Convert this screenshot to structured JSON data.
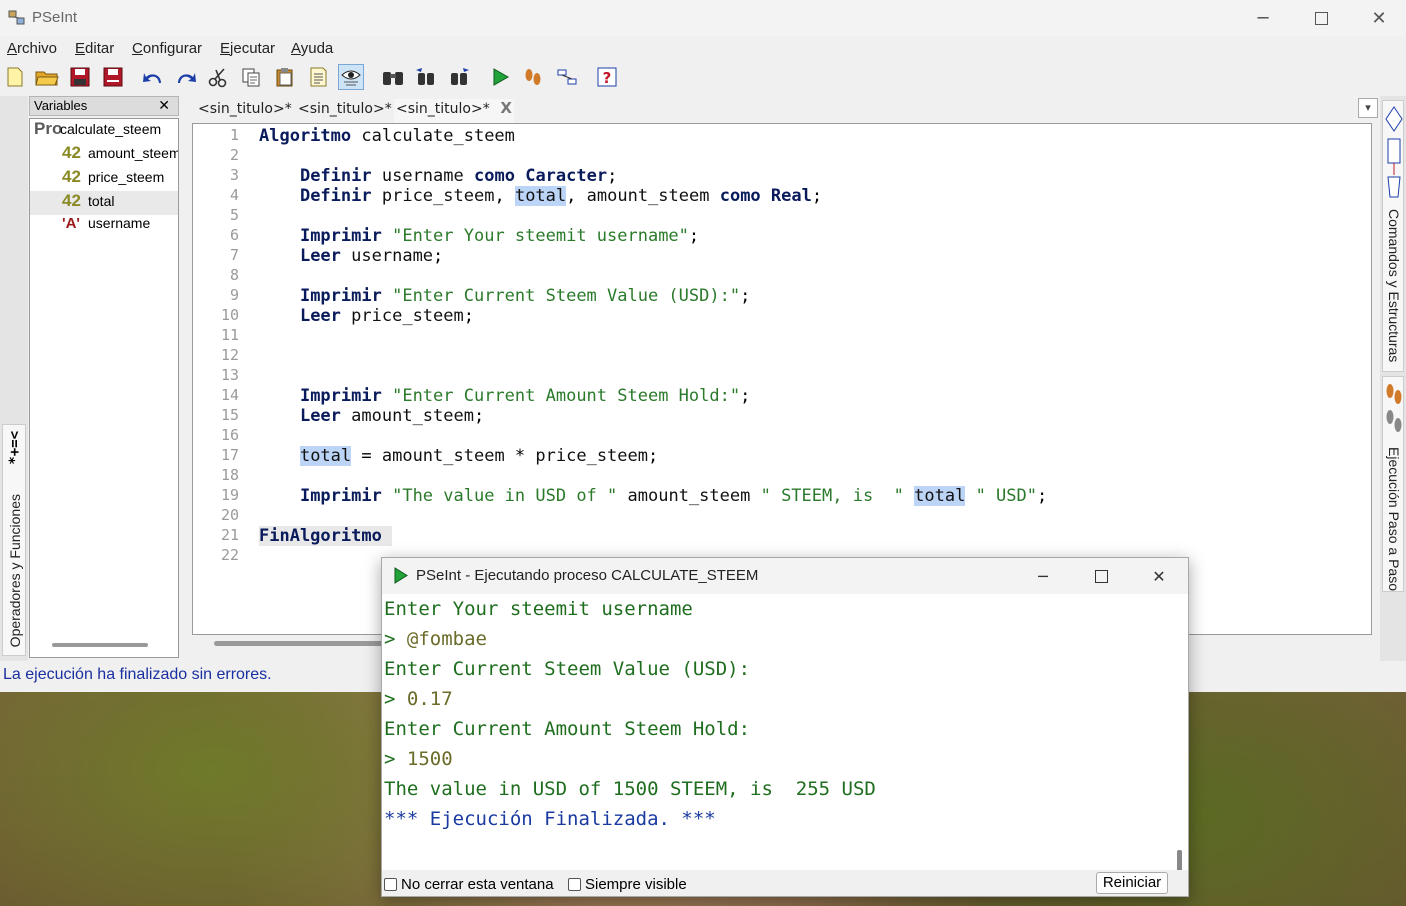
{
  "window": {
    "title": "PSeInt"
  },
  "menu": [
    {
      "ul": "A",
      "rest": "rchivo"
    },
    {
      "ul": "E",
      "rest": "ditar"
    },
    {
      "ul": "C",
      "rest": "onfigurar"
    },
    {
      "ul": "E",
      "rest": "jecutar"
    },
    {
      "ul": "A",
      "rest": "yuda"
    }
  ],
  "variables_panel": {
    "title": "Variables",
    "close": "✕",
    "items": [
      {
        "icon": "Pro",
        "name": "calculate_steem"
      },
      {
        "icon": "42",
        "name": "amount_steem"
      },
      {
        "icon": "42",
        "name": "price_steem"
      },
      {
        "icon": "42",
        "name": "total"
      },
      {
        "icon": "'A'",
        "name": "username"
      }
    ]
  },
  "left_tab": {
    "label": "Operadores y Funciones",
    "symbols": "*+=<"
  },
  "right_tabs": {
    "commands": "Comandos y Estructuras",
    "step": "Ejecución Paso a Paso"
  },
  "status": "La ejecución ha finalizado sin errores.",
  "tabs": [
    {
      "label": "<sin_titulo>*"
    },
    {
      "label": "<sin_titulo>*"
    },
    {
      "label": "<sin_titulo>*",
      "close": "X"
    }
  ],
  "editor": {
    "line_numbers": [
      "1",
      "2",
      "3",
      "4",
      "5",
      "6",
      "7",
      "8",
      "9",
      "10",
      "11",
      "12",
      "13",
      "14",
      "15",
      "16",
      "17",
      "18",
      "19",
      "20",
      "21",
      "22"
    ],
    "kw": {
      "algoritmo": "Algoritmo",
      "definir": "Definir",
      "como": "como",
      "caracter": "Caracter",
      "real": "Real",
      "imprimir": "Imprimir",
      "leer": "Leer",
      "finalgoritmo": "FinAlgoritmo"
    },
    "ids": {
      "name": "calculate_steem",
      "username": "username",
      "price": "price_steem",
      "total": "total",
      "amount": "amount_steem"
    },
    "punct": {
      "semi": ";",
      "comma": ",",
      "assign": " = ",
      "mul": " * "
    },
    "strings": {
      "s1": "\"Enter Your steemit username\"",
      "s2": "\"Enter Current Steem Value (USD):\"",
      "s3": "\"Enter Current Amount Steem Hold:\"",
      "s4": "\"The value in USD of \"",
      "s5": "\" STEEM, is  \"",
      "s6": "\" USD\""
    }
  },
  "run_window": {
    "title": "PSeInt - Ejecutando proceso CALCULATE_STEEM",
    "console": [
      {
        "type": "out",
        "prompt": "",
        "text": "Enter Your steemit username"
      },
      {
        "type": "in",
        "prompt": "> ",
        "text": "@fombae"
      },
      {
        "type": "out",
        "prompt": "",
        "text": "Enter Current Steem Value (USD):"
      },
      {
        "type": "in",
        "prompt": "> ",
        "text": "0.17"
      },
      {
        "type": "out",
        "prompt": "",
        "text": "Enter Current Amount Steem Hold:"
      },
      {
        "type": "in",
        "prompt": "> ",
        "text": "1500"
      },
      {
        "type": "out",
        "prompt": "",
        "text": "The value in USD of 1500 STEEM, is  255 USD"
      },
      {
        "type": "end",
        "prompt": "",
        "text": "*** Ejecución Finalizada. ***"
      }
    ],
    "checkbox_keep_open": "No cerrar esta ventana",
    "checkbox_always_visible": "Siempre visible",
    "restart_button": "Reiniciar"
  },
  "colors": {
    "keyword": "#0a1b5c",
    "string": "#2b7a2b",
    "status": "#1a2fa0",
    "highlight": "#bcd4f5"
  }
}
